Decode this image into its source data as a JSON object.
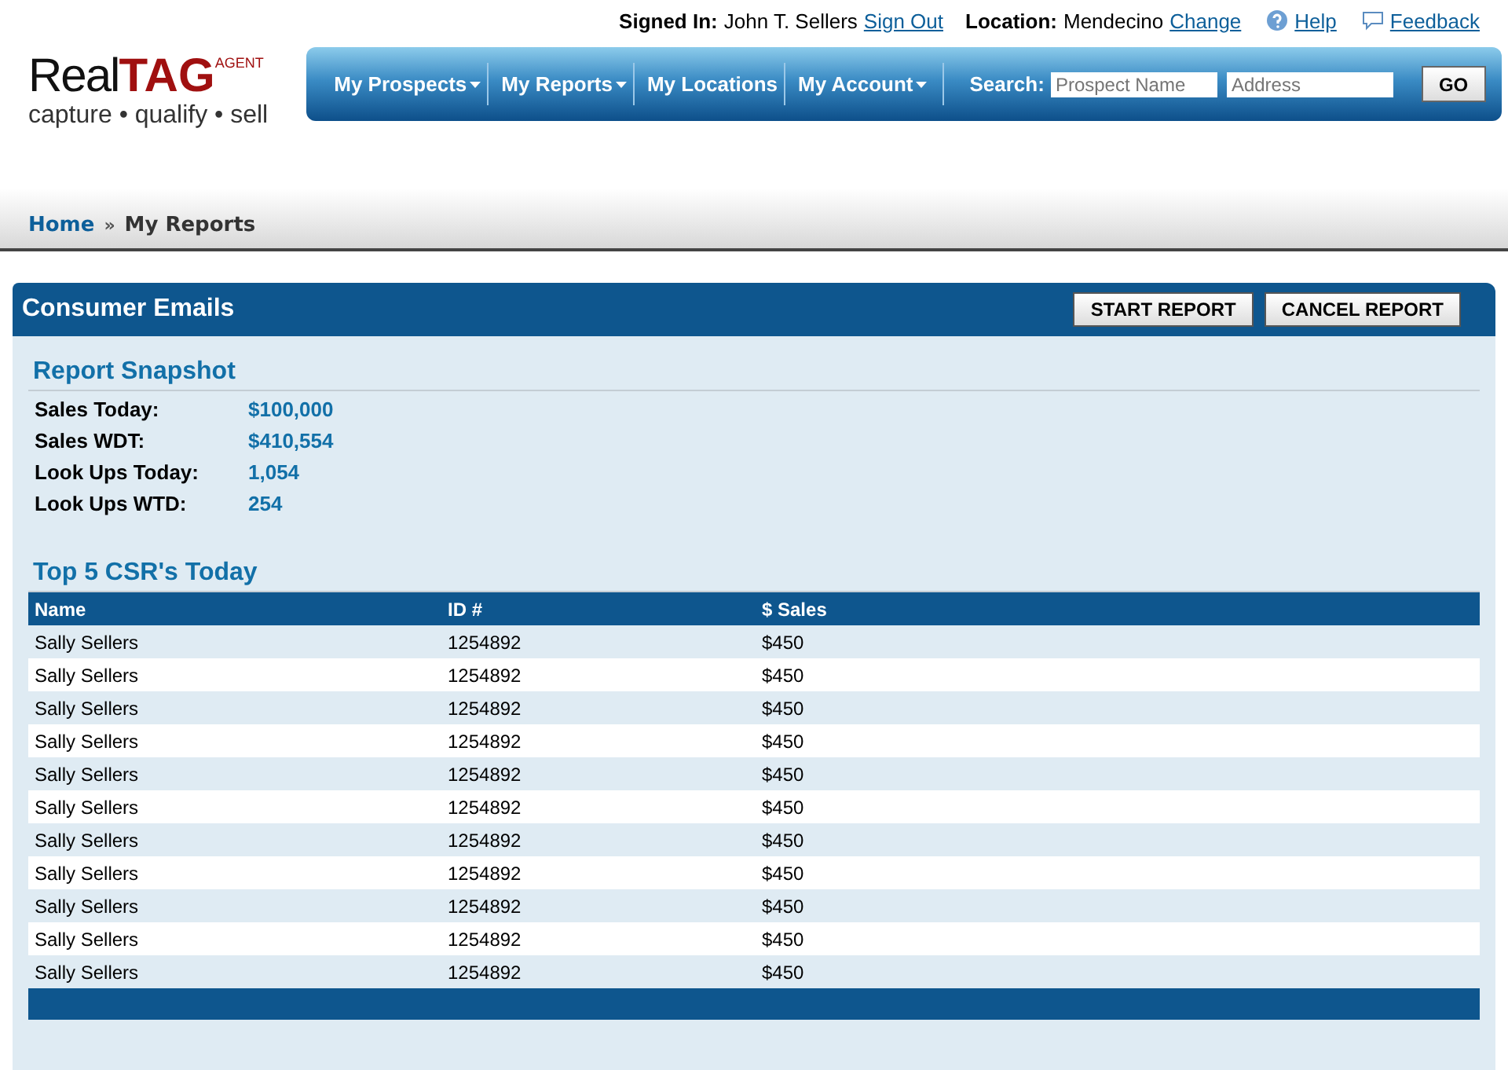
{
  "top_bar": {
    "signed_in_label": "Signed In:",
    "user": "John T. Sellers",
    "sign_out": "Sign Out",
    "location_label": "Location:",
    "location": "Mendecino",
    "change": "Change",
    "help": "Help",
    "feedback": "Feedback"
  },
  "logo": {
    "word_1": "Real",
    "word_2": "TAG",
    "badge": "AGENT",
    "tagline": "capture • qualify • sell"
  },
  "nav": {
    "items": [
      {
        "label": "My Prospects",
        "dropdown": true
      },
      {
        "label": "My Reports",
        "dropdown": true
      },
      {
        "label": "My Locations",
        "dropdown": false
      },
      {
        "label": "My Account",
        "dropdown": true
      }
    ],
    "search_label": "Search:",
    "search_fields": [
      {
        "placeholder": "Prospect Name"
      },
      {
        "placeholder": "Address"
      }
    ],
    "go": "GO"
  },
  "breadcrumb": {
    "separator": "»",
    "items": [
      {
        "label": "Home"
      },
      {
        "label": "My Reports"
      }
    ]
  },
  "panel": {
    "title": "Consumer Emails",
    "buttons": [
      "START REPORT",
      "CANCEL REPORT"
    ],
    "snapshot": {
      "title": "Report Snapshot",
      "stats": [
        {
          "label": "Sales Today:",
          "value": "$100,000"
        },
        {
          "label": "Sales WDT:",
          "value": "$410,554"
        },
        {
          "label": "Look Ups Today:",
          "value": "1,054"
        },
        {
          "label": "Look Ups WTD:",
          "value": "254"
        }
      ]
    },
    "top_csr": {
      "title": "Top 5 CSR's Today",
      "columns": [
        "Name",
        "ID #",
        "$ Sales"
      ],
      "rows": [
        [
          "Sally Sellers",
          "1254892",
          "$450"
        ],
        [
          "Sally Sellers",
          "1254892",
          "$450"
        ],
        [
          "Sally Sellers",
          "1254892",
          "$450"
        ],
        [
          "Sally Sellers",
          "1254892",
          "$450"
        ],
        [
          "Sally Sellers",
          "1254892",
          "$450"
        ],
        [
          "Sally Sellers",
          "1254892",
          "$450"
        ],
        [
          "Sally Sellers",
          "1254892",
          "$450"
        ],
        [
          "Sally Sellers",
          "1254892",
          "$450"
        ],
        [
          "Sally Sellers",
          "1254892",
          "$450"
        ],
        [
          "Sally Sellers",
          "1254892",
          "$450"
        ],
        [
          "Sally Sellers",
          "1254892",
          "$450"
        ]
      ]
    }
  }
}
